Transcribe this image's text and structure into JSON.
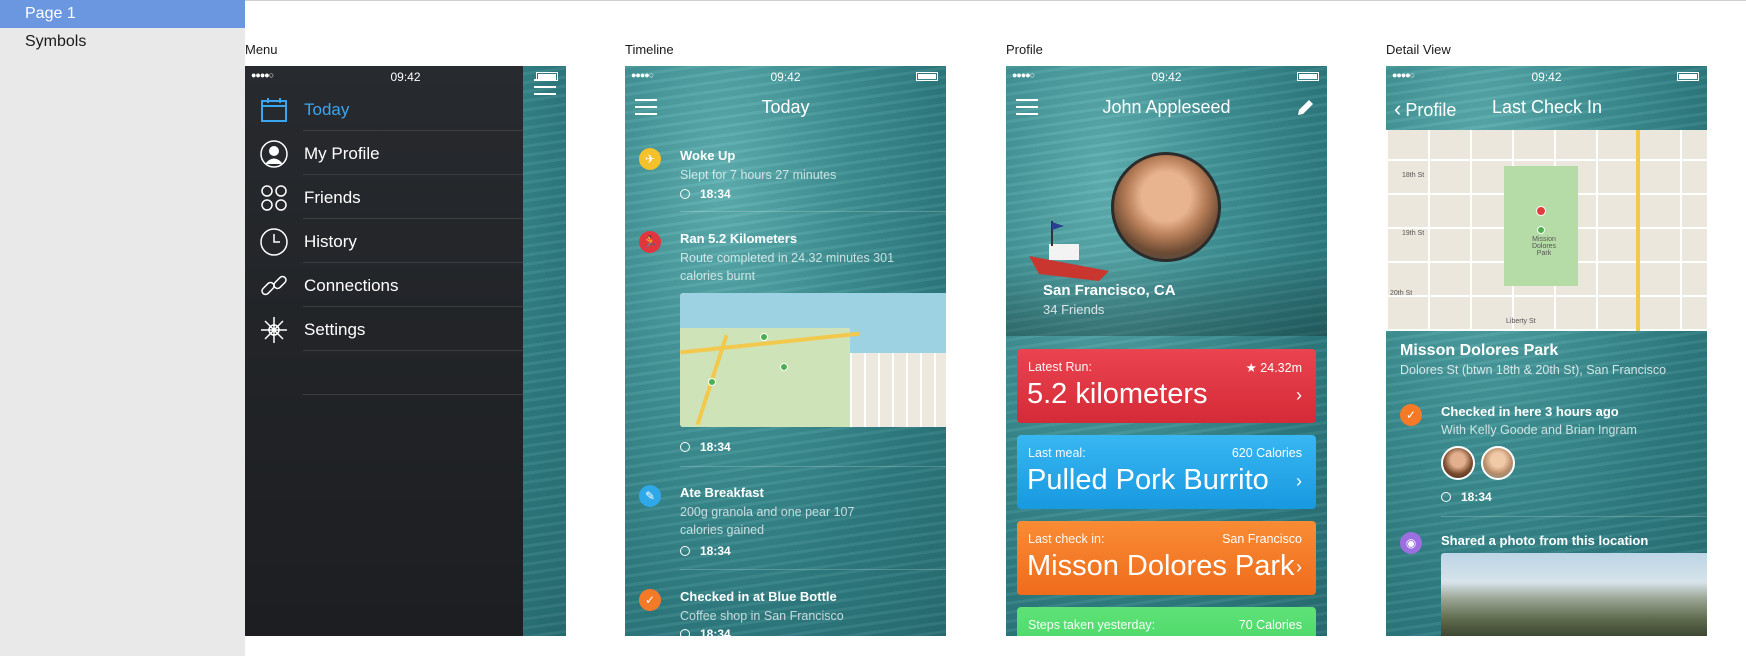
{
  "pages": {
    "items": [
      {
        "label": "Page 1",
        "selected": true
      },
      {
        "label": "Symbols",
        "selected": false
      }
    ]
  },
  "artboards": {
    "menu": "Menu",
    "timeline": "Timeline",
    "profile": "Profile",
    "detail": "Detail View"
  },
  "status": {
    "time": "09:42"
  },
  "menu": {
    "items": [
      {
        "label": "Today",
        "icon": "calendar-icon",
        "active": true
      },
      {
        "label": "My Profile",
        "icon": "user-icon",
        "active": false
      },
      {
        "label": "Friends",
        "icon": "friends-icon",
        "active": false
      },
      {
        "label": "History",
        "icon": "clock-icon",
        "active": false
      },
      {
        "label": "Connections",
        "icon": "link-icon",
        "active": false
      },
      {
        "label": "Settings",
        "icon": "gear-icon",
        "active": false
      }
    ]
  },
  "timeline": {
    "title": "Today",
    "entries": [
      {
        "title": "Woke Up",
        "desc": "Slept for 7 hours 27 minutes",
        "time": "18:34",
        "color": "#f5c12b"
      },
      {
        "title": "Ran 5.2 Kilometers",
        "desc": "Route completed in 24.32 minutes 301 calories burnt",
        "time": "18:34",
        "color": "#e2363f"
      },
      {
        "title": "Ate Breakfast",
        "desc": "200g granola and one pear 107 calories gained",
        "time": "18:34",
        "color": "#2fa8ea"
      },
      {
        "title": "Checked in at Blue Bottle",
        "desc": "Coffee shop in San Francisco",
        "time": "18:34",
        "color": "#f47a27"
      }
    ]
  },
  "profile": {
    "name": "John Appleseed",
    "location": "San Francisco, CA",
    "friends": "34 Friends",
    "cards": [
      {
        "label": "Latest Run:",
        "right": "★ 24.32m",
        "value": "5.2 kilometers",
        "color": "#e43642"
      },
      {
        "label": "Last meal:",
        "right": "620 Calories",
        "value": "Pulled Pork Burrito",
        "color": "#21a6ea"
      },
      {
        "label": "Last check in:",
        "right": "San Francisco",
        "value": "Misson Dolores Park",
        "color": "#f47a27"
      },
      {
        "label": "Steps taken yesterday:",
        "right": "70 Calories",
        "value": "",
        "color": "#4fd96a"
      }
    ]
  },
  "detail": {
    "back": "Profile",
    "title": "Last Check In",
    "place": "Misson Dolores Park",
    "address": "Dolores St (btwn 18th & 20th St), San Francisco",
    "checkin": "Checked in here 3 hours ago",
    "with": "With Kelly Goode and Brian Ingram",
    "time": "18:34",
    "shared": "Shared a photo from this location",
    "map_labels": {
      "street1": "18th St",
      "street2": "19th St",
      "street3": "20th St",
      "street4": "Liberty St",
      "park": "Mission Dolores Park"
    }
  }
}
